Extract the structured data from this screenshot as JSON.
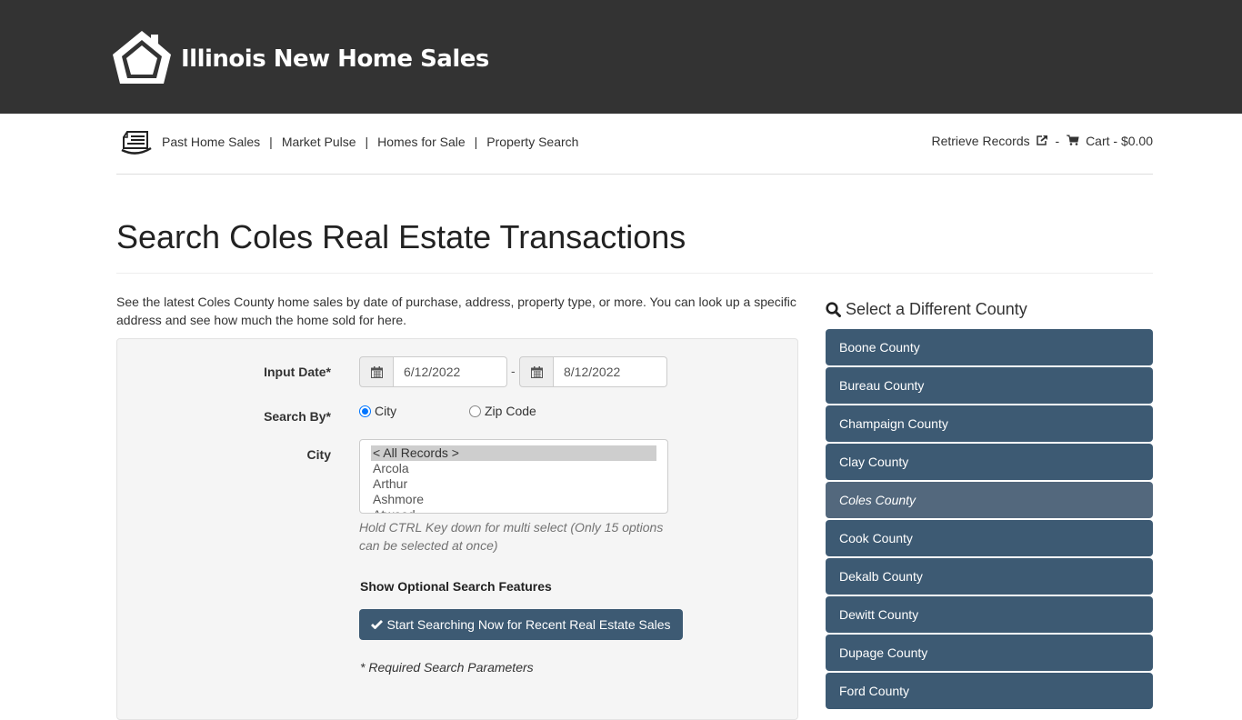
{
  "header": {
    "site_title": "Illinois New Home Sales",
    "logo_icon": "house-icon"
  },
  "nav": {
    "icon": "newspaper-icon",
    "links": [
      "Past Home Sales",
      "Market Pulse",
      "Homes for Sale",
      "Property Search"
    ],
    "separator": "|",
    "retrieve_records": "Retrieve Records",
    "retrieve_icon": "external-link-icon",
    "dash": "-",
    "cart_icon": "cart-icon",
    "cart": "Cart - $0.00"
  },
  "page": {
    "title": "Search Coles Real Estate Transactions",
    "intro": "See the latest Coles County home sales by date of purchase, address, property type, or more. You can look up a specific address and see how much the home sold for here."
  },
  "form": {
    "input_date_label": "Input Date*",
    "date_from": "6/12/2022",
    "date_to": "8/12/2022",
    "date_separator": "-",
    "search_by_label": "Search By*",
    "search_by_options": [
      {
        "label": "City",
        "checked": true
      },
      {
        "label": "Zip Code",
        "checked": false
      }
    ],
    "city_label": "City",
    "city_options": [
      "< All Records >",
      "Arcola",
      "Arthur",
      "Ashmore",
      "Atwood"
    ],
    "city_selected": "< All Records >",
    "help_text": "Hold CTRL Key down for multi select (Only 15 options can be selected at once)",
    "optional_features": "Show Optional Search Features",
    "submit_label": "Start Searching Now for Recent Real Estate Sales",
    "required_note": "* Required Search Parameters"
  },
  "sidebar": {
    "heading": "Select a Different County",
    "counties": [
      "Boone County",
      "Bureau County",
      "Champaign County",
      "Clay County",
      "Coles County",
      "Cook County",
      "Dekalb County",
      "Dewitt County",
      "Dupage County",
      "Ford County"
    ],
    "active": "Coles County"
  },
  "colors": {
    "topbar": "#333333",
    "button": "#3d5a73",
    "active_county": "#53687d",
    "radio": "#0075ff"
  }
}
